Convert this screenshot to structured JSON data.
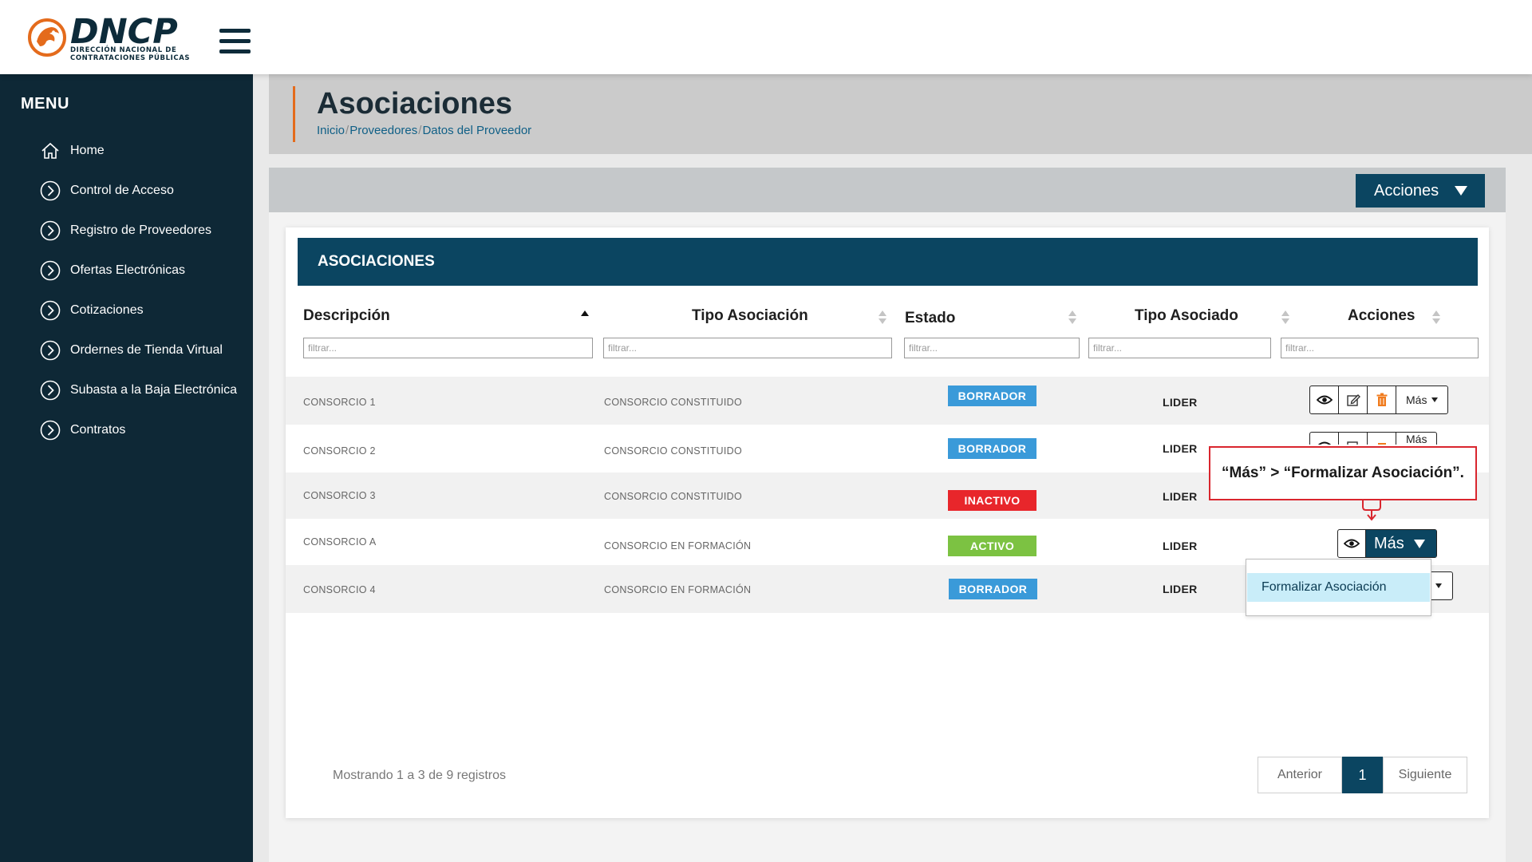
{
  "brand": {
    "logo_text": "DNCP",
    "logo_sub1": "DIRECCIÓN NACIONAL DE",
    "logo_sub2": "CONTRATACIONES PÚBLICAS",
    "accent_color": "#e46b1c",
    "primary_color": "#0b4561"
  },
  "sidebar": {
    "title": "MENU",
    "items": [
      {
        "label": "Home",
        "icon": "home-icon"
      },
      {
        "label": "Control de Acceso",
        "icon": "chevron-circle-icon"
      },
      {
        "label": "Registro de Proveedores",
        "icon": "chevron-circle-icon"
      },
      {
        "label": "Ofertas Electrónicas",
        "icon": "chevron-circle-icon"
      },
      {
        "label": "Cotizaciones",
        "icon": "chevron-circle-icon"
      },
      {
        "label": "Ordernes de Tienda Virtual",
        "icon": "chevron-circle-icon"
      },
      {
        "label": "Subasta a la Baja Electrónica",
        "icon": "chevron-circle-icon"
      },
      {
        "label": "Contratos",
        "icon": "chevron-circle-icon"
      }
    ]
  },
  "page": {
    "title": "Asociaciones",
    "breadcrumb": [
      "Inicio",
      "Proveedores",
      "Datos del Proveedor"
    ],
    "actions_label": "Acciones"
  },
  "table": {
    "header": "ASOCIACIONES",
    "columns": [
      "Descripción",
      "Tipo Asociación",
      "Estado",
      "Tipo Asociado",
      "Acciones"
    ],
    "filter_placeholder": "filtrar...",
    "rows": [
      {
        "descripcion": "CONSORCIO 1",
        "tipo": "CONSORCIO CONSTITUIDO",
        "estado": "BORRADOR",
        "estado_color": "#3a9ad9",
        "asociado": "LIDER"
      },
      {
        "descripcion": "CONSORCIO 2",
        "tipo": "CONSORCIO CONSTITUIDO",
        "estado": "BORRADOR",
        "estado_color": "#3a9ad9",
        "asociado": "LIDER"
      },
      {
        "descripcion": "CONSORCIO 3",
        "tipo": "CONSORCIO CONSTITUIDO",
        "estado": "INACTIVO",
        "estado_color": "#e8262b",
        "asociado": "LIDER"
      },
      {
        "descripcion": "CONSORCIO A",
        "tipo": "CONSORCIO EN FORMACIÓN",
        "estado": "ACTIVO",
        "estado_color": "#7cc242",
        "asociado": "LIDER"
      },
      {
        "descripcion": "CONSORCIO 4",
        "tipo": "CONSORCIO EN FORMACIÓN",
        "estado": "BORRADOR",
        "estado_color": "#3a9ad9",
        "asociado": "LIDER"
      }
    ],
    "more_label": "Más",
    "dropdown_item": "Formalizar Asociación",
    "showing_text": "Mostrando 1 a 3 de 9 registros",
    "pagination": {
      "prev": "Anterior",
      "current": "1",
      "next": "Siguiente"
    }
  },
  "annotation": {
    "text": "“Más” > “Formalizar Asociación”."
  }
}
